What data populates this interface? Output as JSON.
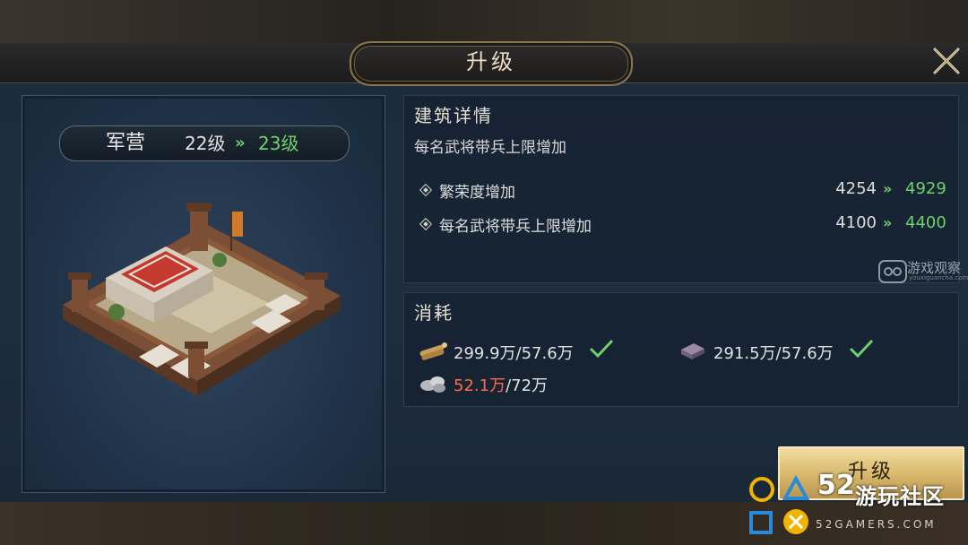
{
  "title": "升级",
  "building": {
    "name": "军营",
    "level_from": "22级",
    "level_to": "23级",
    "arrow": "»"
  },
  "details": {
    "heading": "建筑详情",
    "subtitle": "每名武将带兵上限增加",
    "rows": [
      {
        "label": "繁荣度增加",
        "from": "4254",
        "to": "4929"
      },
      {
        "label": "每名武将带兵上限增加",
        "from": "4100",
        "to": "4400"
      }
    ]
  },
  "cost": {
    "heading": "消耗",
    "items": [
      {
        "icon": "wood-icon",
        "value": "299.9万/57.6万",
        "sufficient": true
      },
      {
        "icon": "iron-icon",
        "value": "291.5万/57.6万",
        "sufficient": true
      },
      {
        "icon": "stone-icon",
        "have": "52.1万",
        "need": "/72万",
        "sufficient": false
      }
    ]
  },
  "upgrade_button": "升级",
  "watermark": {
    "text": "游戏观察",
    "sub": "youxiguancha.com"
  },
  "logo": {
    "number": "52",
    "name": "游玩社区",
    "domain": "52GAMERS.COM"
  },
  "colors": {
    "green": "#6fd06c",
    "red": "#ff6a4a",
    "gold": "#d7b76a"
  }
}
